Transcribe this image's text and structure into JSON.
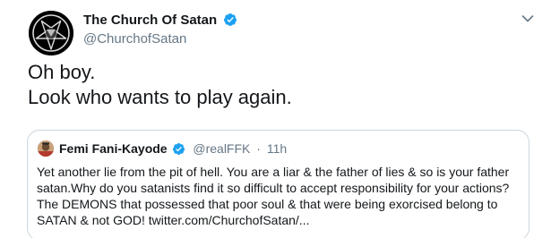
{
  "tweet": {
    "author_name": "The Church Of Satan",
    "author_handle": "@ChurchofSatan",
    "text_lines": [
      "Oh boy.",
      "Look who wants to play again."
    ],
    "verified": true,
    "icons": {
      "avatar": "baphomet-sigil-avatar",
      "verified": "verified-badge-icon",
      "menu": "chevron-down-icon"
    }
  },
  "quote": {
    "author_name": "Femi Fani-Kayode",
    "author_handle": "@realFFK",
    "separator": "·",
    "time": "11h",
    "verified": true,
    "text_lines": [
      "Yet another lie from the pit of hell. You are a liar & the father of lies & so is your father",
      "satan.Why do you satanists find it so difficult to accept responsibility for your actions?",
      "The DEMONS that possessed that poor soul & that were being exorcised belong to",
      "SATAN & not GOD! twitter.com/ChurchofSatan/..."
    ]
  },
  "colors": {
    "text_primary": "#14171a",
    "text_secondary": "#657786",
    "verified_blue": "#1da1f2",
    "border": "#ccd6dd",
    "background": "#ffffff"
  }
}
